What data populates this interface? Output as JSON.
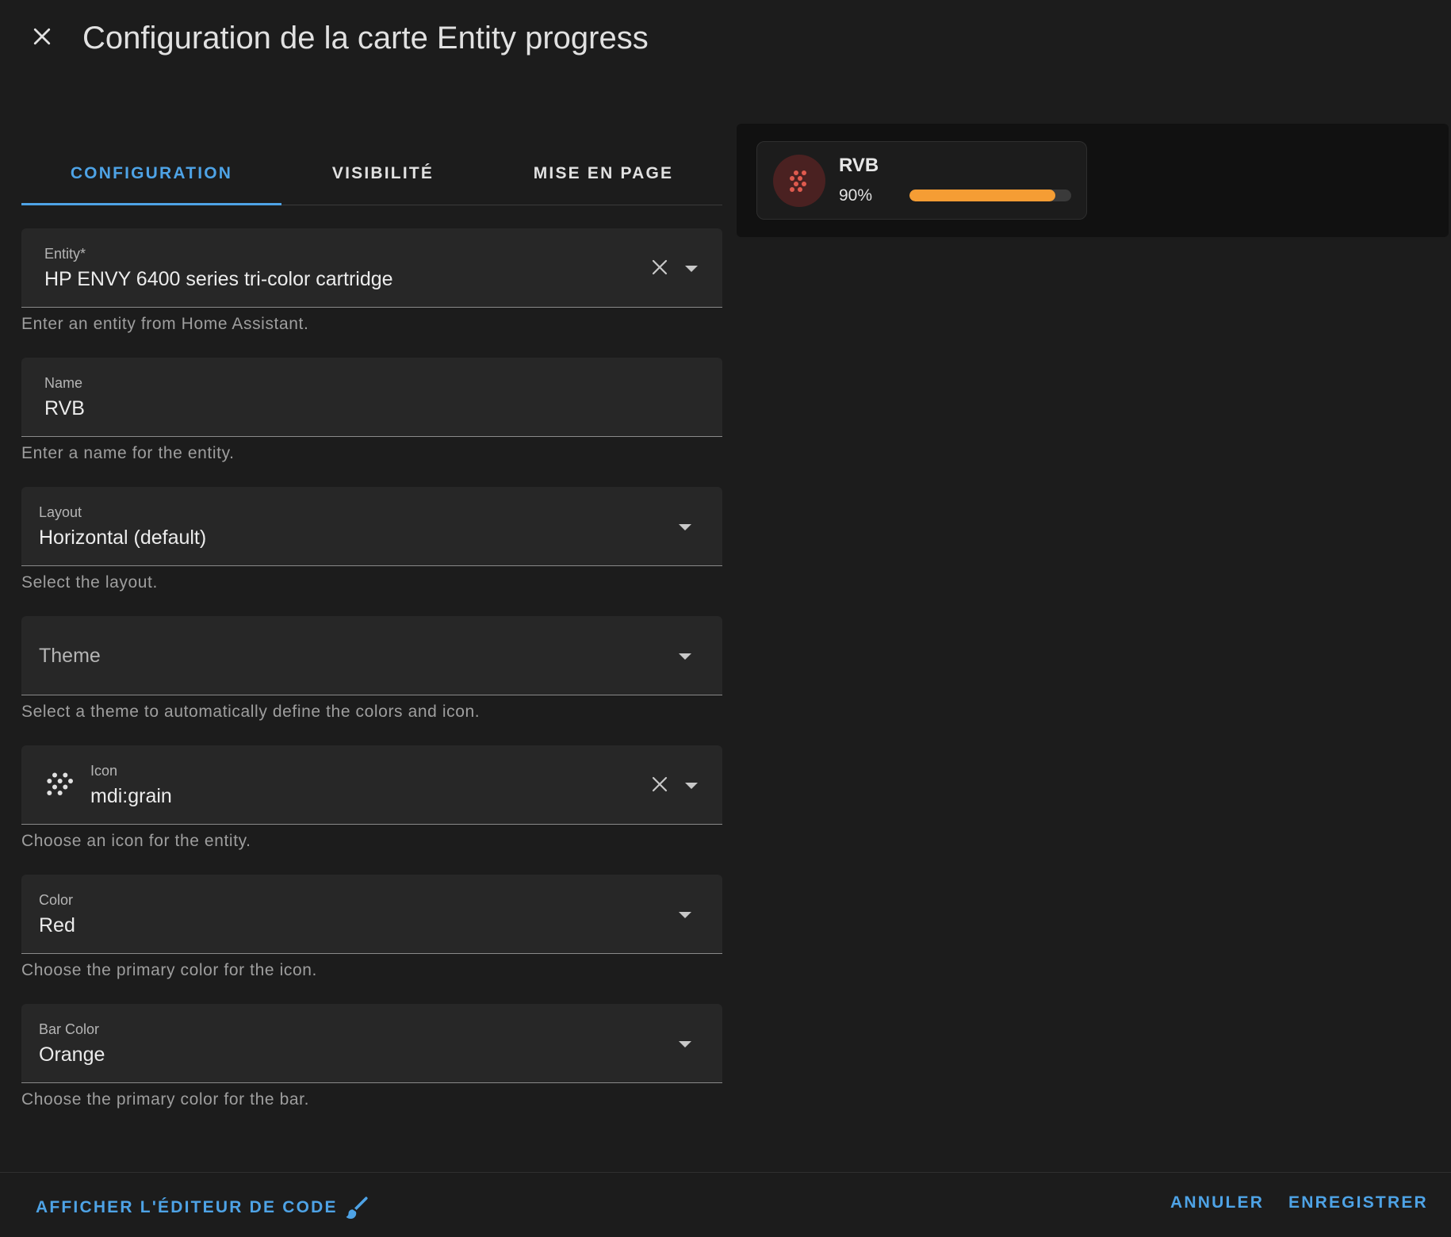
{
  "dialog": {
    "title": "Configuration de la carte Entity progress"
  },
  "tabs": [
    {
      "label": "CONFIGURATION",
      "active": true
    },
    {
      "label": "VISIBILITÉ",
      "active": false
    },
    {
      "label": "MISE EN PAGE",
      "active": false
    }
  ],
  "fields": {
    "entity": {
      "label": "Entity*",
      "value": "HP ENVY 6400 series tri-color cartridge",
      "helper": "Enter an entity from Home Assistant."
    },
    "name": {
      "label": "Name",
      "value": "RVB",
      "helper": "Enter a name for the entity."
    },
    "layout": {
      "label": "Layout",
      "value": "Horizontal (default)",
      "helper": "Select the layout."
    },
    "theme": {
      "label": "Theme",
      "value": "",
      "helper": "Select a theme to automatically define the colors and icon."
    },
    "icon": {
      "label": "Icon",
      "value": "mdi:grain",
      "icon_name": "grain-icon",
      "helper": "Choose an icon for the entity."
    },
    "color": {
      "label": "Color",
      "value": "Red",
      "helper": "Choose the primary color for the icon."
    },
    "bar_color": {
      "label": "Bar Color",
      "value": "Orange",
      "helper": "Choose the primary color for the bar."
    }
  },
  "preview": {
    "name": "RVB",
    "percent_label": "90%",
    "progress": 0.9,
    "icon_name": "grain-icon",
    "icon_color": "#e05a4e",
    "icon_bg": "#4a2121",
    "bar_color": "#f59d34"
  },
  "footer": {
    "code_editor_label": "AFFICHER L'ÉDITEUR DE CODE",
    "cancel_label": "ANNULER",
    "save_label": "ENREGISTRER"
  },
  "colors": {
    "accent": "#4ea3e6",
    "background": "#1c1c1c",
    "field_bg": "#272727"
  }
}
